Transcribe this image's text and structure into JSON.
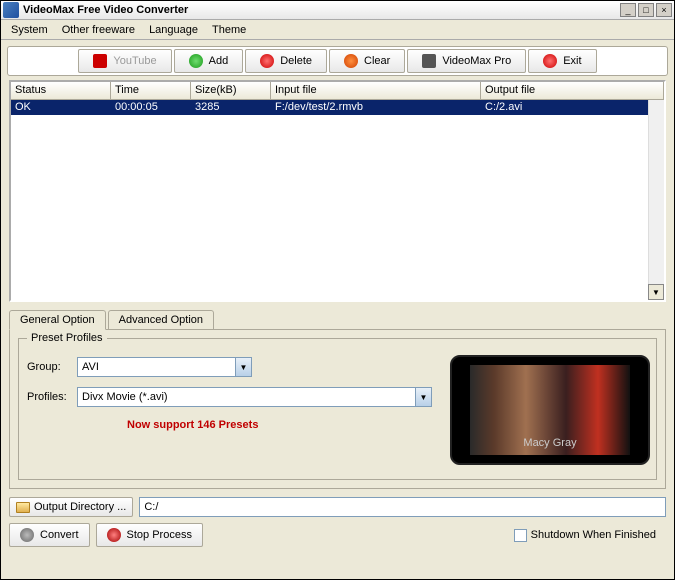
{
  "window": {
    "title": "VideoMax Free Video Converter"
  },
  "menu": {
    "system": "System",
    "other": "Other freeware",
    "language": "Language",
    "theme": "Theme"
  },
  "toolbar": {
    "youtube": "YouTube",
    "add": "Add",
    "delete": "Delete",
    "clear": "Clear",
    "pro": "VideoMax Pro",
    "exit": "Exit"
  },
  "list": {
    "headers": {
      "status": "Status",
      "time": "Time",
      "size": "Size(kB)",
      "input": "Input file",
      "output": "Output file"
    },
    "rows": [
      {
        "status": "OK",
        "time": "00:00:05",
        "size": "3285",
        "input": "F:/dev/test/2.rmvb",
        "output": "C:/2.avi"
      }
    ]
  },
  "tabs": {
    "general": "General Option",
    "advanced": "Advanced Option"
  },
  "preset": {
    "legend": "Preset Profiles",
    "group_label": "Group:",
    "group_value": "AVI",
    "profiles_label": "Profiles:",
    "profiles_value": "Divx Movie (*.avi)",
    "promo": "Now support 146 Presets",
    "device_caption": "Macy Gray"
  },
  "output": {
    "btn": "Output Directory ...",
    "value": "C:/"
  },
  "actions": {
    "convert": "Convert",
    "stop": "Stop Process",
    "shutdown": "Shutdown When Finished"
  }
}
